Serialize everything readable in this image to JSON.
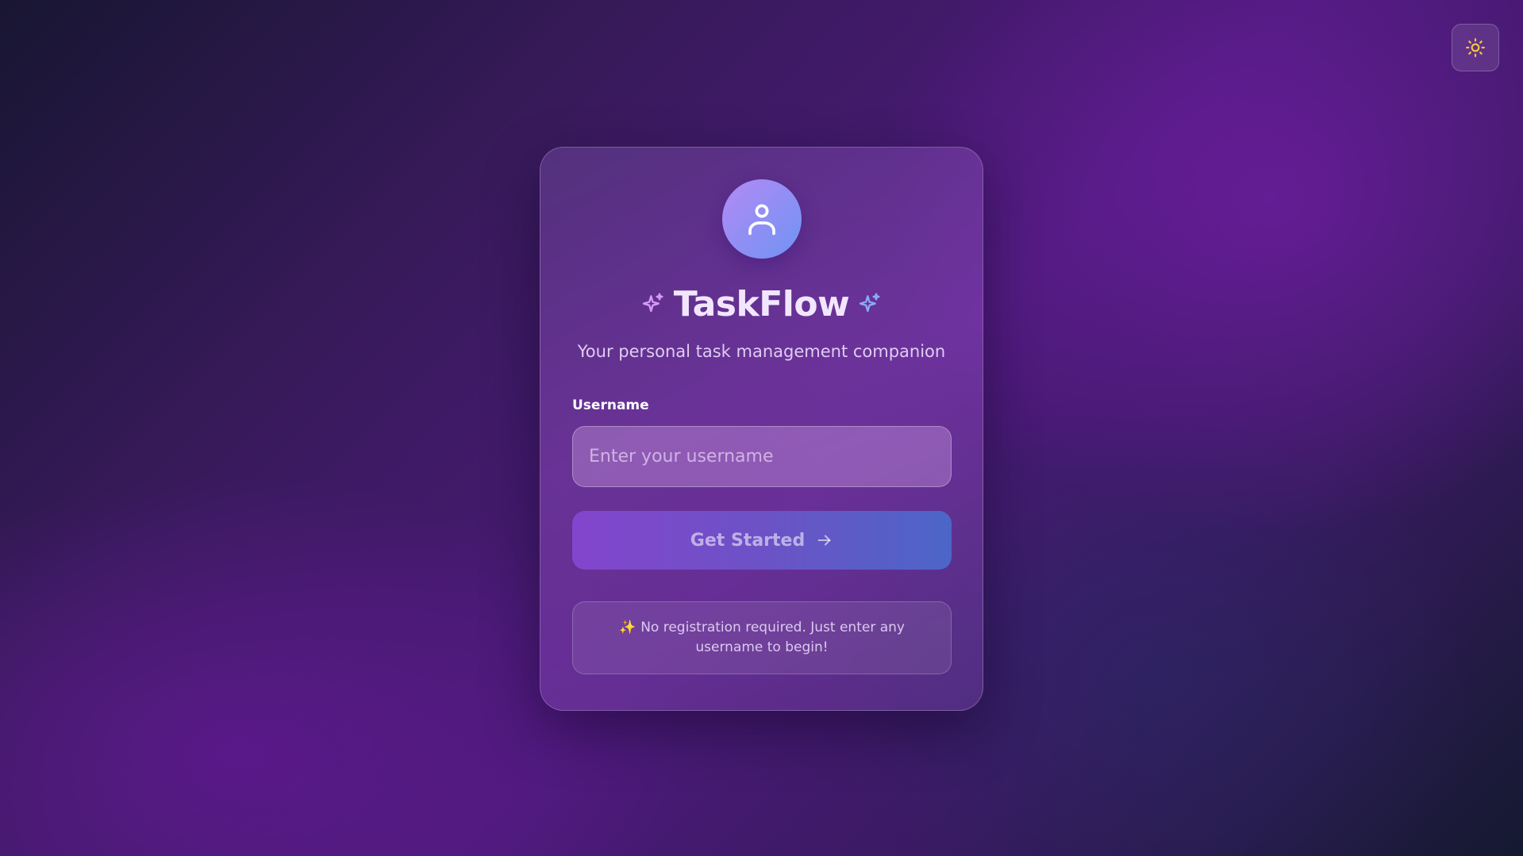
{
  "theme_toggle": {
    "icon": "sun-icon",
    "color": "#f5c542"
  },
  "header": {
    "avatar_icon": "user-icon",
    "title": "TaskFlow",
    "sparkle_left_color": "#d49af5",
    "sparkle_right_color": "#8aaaf6",
    "subtitle": "Your personal task management companion"
  },
  "form": {
    "username_label": "Username",
    "username_placeholder": "Enter your username",
    "username_value": "",
    "submit_label": "Get Started",
    "submit_icon": "arrow-right-icon"
  },
  "note": {
    "emoji": "✨",
    "text": "No registration required. Just enter any username to begin!"
  },
  "colors": {
    "accent_start": "#8345cd",
    "accent_end": "#4c66c8"
  }
}
